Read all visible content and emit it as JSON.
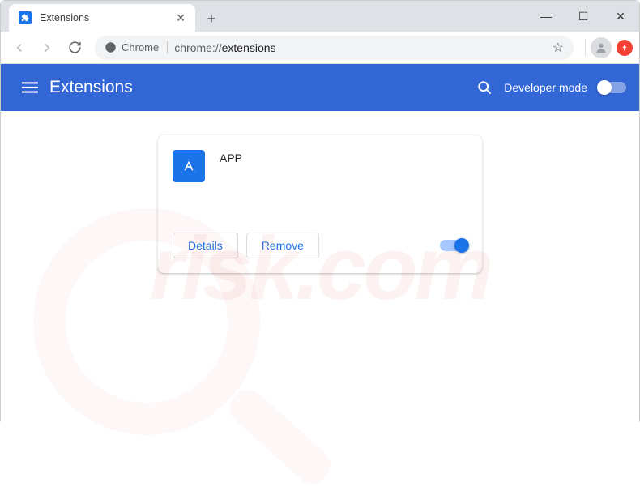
{
  "window": {
    "tab_title": "Extensions",
    "minimize": "—",
    "maximize": "☐",
    "close": "✕",
    "newtab": "+",
    "tabclose": "✕"
  },
  "toolbar": {
    "chip_label": "Chrome",
    "url_prefix": "chrome://",
    "url_path": "extensions"
  },
  "appbar": {
    "title": "Extensions",
    "dev_mode_label": "Developer mode"
  },
  "extension": {
    "name": "APP",
    "details_label": "Details",
    "remove_label": "Remove"
  },
  "watermark": {
    "text": "risk.com"
  }
}
